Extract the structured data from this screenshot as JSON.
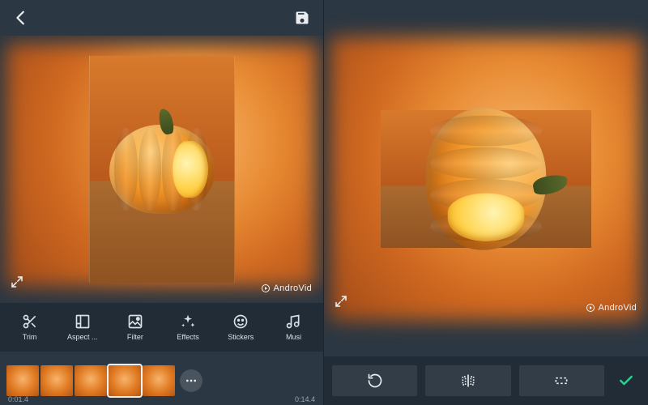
{
  "left": {
    "topbar": {
      "back": "back",
      "save": "save"
    },
    "watermark": "AndroVid",
    "tools": [
      {
        "id": "trim",
        "label": "Trim"
      },
      {
        "id": "aspect",
        "label": "Aspect ..."
      },
      {
        "id": "filter",
        "label": "Filter"
      },
      {
        "id": "effects",
        "label": "Effects"
      },
      {
        "id": "stickers",
        "label": "Stickers"
      },
      {
        "id": "music",
        "label": "Musi"
      }
    ],
    "timeline": {
      "thumbs": 5,
      "start_time": "0:01.4",
      "end_time": "0:14.4"
    }
  },
  "right": {
    "watermark": "AndroVid",
    "controls": [
      {
        "id": "rotate"
      },
      {
        "id": "flip"
      },
      {
        "id": "crop"
      },
      {
        "id": "confirm"
      }
    ]
  }
}
